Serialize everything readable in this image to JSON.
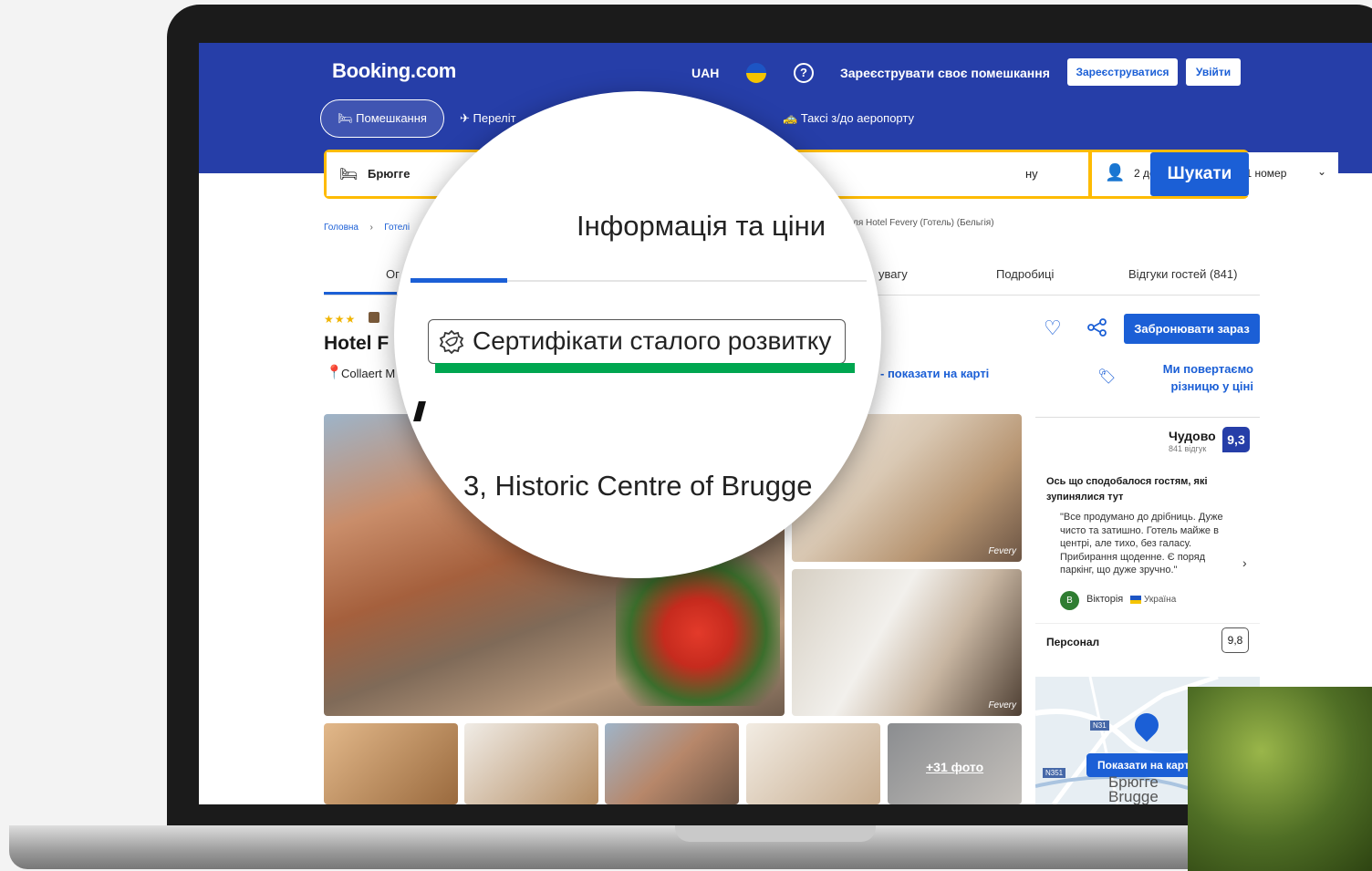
{
  "header": {
    "logo": "Booking.com",
    "currency": "UAH",
    "help_glyph": "?",
    "register_property": "Зареєструвати своє помешкання",
    "register_button": "Зареєструватися",
    "login_button": "Увійти"
  },
  "nav": {
    "stays": "Помешкання",
    "flights": "Переліт",
    "taxi": "Таксі з/до аеропорту"
  },
  "search": {
    "destination": "Брюгге",
    "dates_partial": "ну",
    "guests": "2 дорослих · 0 дітей · 1 номер",
    "button": "Шукати"
  },
  "breadcrumb": {
    "home": "Головна",
    "hotels": "Готелі",
    "tail": "ля Hotel Fevery (Готель) (Бельгія)"
  },
  "tabs": {
    "overview_partial": "Ог",
    "rules_partial": "увагу",
    "details": "Подробиці",
    "reviews": "Відгуки гостей (841)"
  },
  "hotel": {
    "stars": "★★★",
    "name_partial": "Hotel F",
    "address_partial": "Collaert M",
    "show_on_map": "- показати на карті",
    "book_now": "Забронювати зараз",
    "price_match": "Ми повертаємо різницю у ціні"
  },
  "photos": {
    "more": "+31 фото",
    "watermark": "Fevery"
  },
  "reviews": {
    "rating_word": "Чудово",
    "rating_count": "841 відгук",
    "score": "9,3",
    "heading": "Ось що сподобалося гостям, які зупинялися тут",
    "quote": "\"Все продумано до дрібниць. Дуже чисто та затишно. Готель майже в центрі, але тихо, без галасу. Прибирання щоденне. Є поряд паркінг, що дуже зручно.\"",
    "reviewer_initial": "В",
    "reviewer": "Вікторія",
    "country": "Україна",
    "staff_label": "Персонал",
    "staff_score": "9,8"
  },
  "map": {
    "button": "Показати на карті",
    "city_ua": "Брюгге",
    "city_en": "Brugge",
    "road1": "N31",
    "road2": "N351"
  },
  "magnifier": {
    "section_title": "Інформація та ціни",
    "certificate_label": "Сертифікати сталого розвитку",
    "address_text": "3, Historic Centre of Brugge"
  },
  "colors": {
    "brand_blue": "#263ea8",
    "link_blue": "#1b5fd6",
    "search_yellow": "#febb02",
    "highlight_green": "#00a650"
  }
}
